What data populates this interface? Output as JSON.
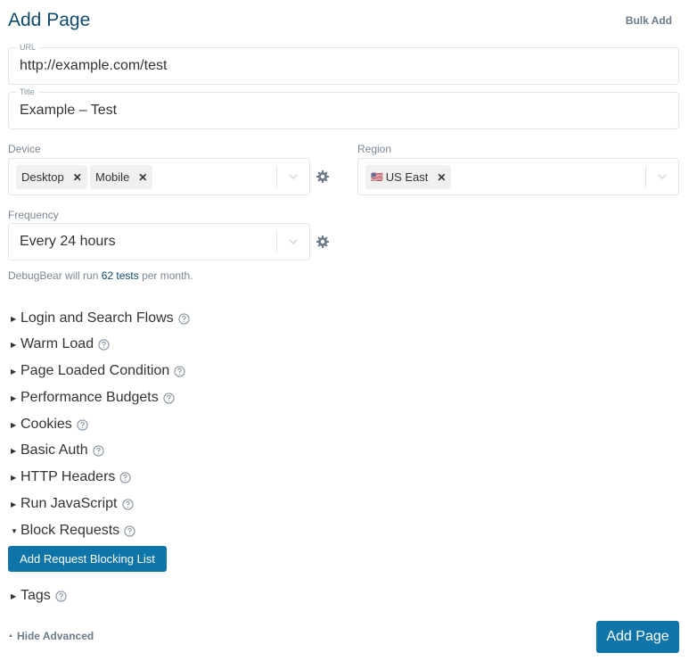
{
  "header": {
    "title": "Add Page",
    "bulk_add_label": "Bulk Add"
  },
  "url_field": {
    "legend": "URL",
    "value": "http://example.com/test"
  },
  "title_field": {
    "legend": "Title",
    "value": "Example – Test"
  },
  "device": {
    "label": "Device",
    "chips": [
      "Desktop",
      "Mobile"
    ],
    "icon": "gear-icon"
  },
  "region": {
    "label": "Region",
    "chips": [
      {
        "flag": "🇺🇸",
        "label": "US East"
      }
    ]
  },
  "frequency": {
    "label": "Frequency",
    "value": "Every 24 hours",
    "icon": "gear-icon"
  },
  "info": {
    "prefix": "DebugBear will run ",
    "highlight": "62 tests",
    "suffix": " per month."
  },
  "sections": [
    {
      "label": "Login and Search Flows",
      "expanded": false
    },
    {
      "label": "Warm Load",
      "expanded": false
    },
    {
      "label": "Page Loaded Condition",
      "expanded": false
    },
    {
      "label": "Performance Budgets",
      "expanded": false
    },
    {
      "label": "Cookies",
      "expanded": false
    },
    {
      "label": "Basic Auth",
      "expanded": false
    },
    {
      "label": "HTTP Headers",
      "expanded": false
    },
    {
      "label": "Run JavaScript",
      "expanded": false
    },
    {
      "label": "Block Requests",
      "expanded": true
    },
    {
      "label": "Tags",
      "expanded": false
    }
  ],
  "block_requests_button": "Add Request Blocking List",
  "footer": {
    "hide_advanced_label": "Hide Advanced",
    "submit_label": "Add Page"
  },
  "colors": {
    "primary": "#0f74a7",
    "title": "#0e4a6e",
    "muted": "#7a8794"
  }
}
